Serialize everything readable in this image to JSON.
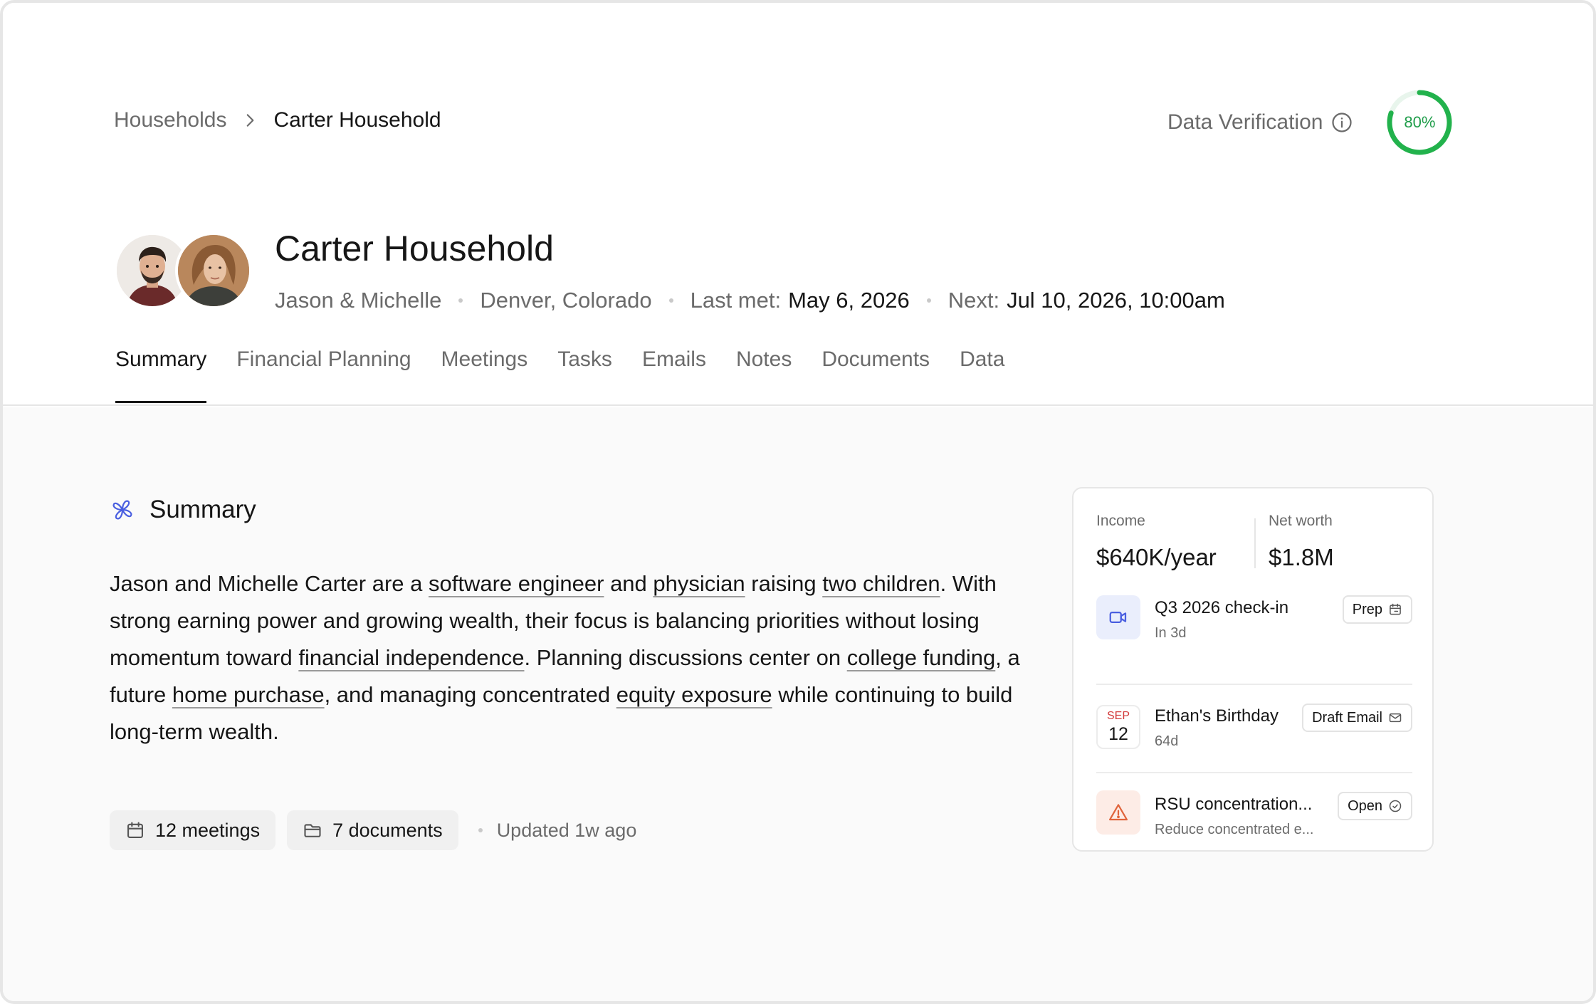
{
  "breadcrumb": {
    "parent": "Households",
    "current": "Carter Household"
  },
  "verification": {
    "label": "Data Verification",
    "percent_text": "80%",
    "progress": 0.8,
    "color": "#22b24c"
  },
  "household": {
    "title": "Carter Household",
    "members": "Jason & Michelle",
    "location": "Denver, Colorado",
    "last_met_label": "Last met:",
    "last_met_value": "May 6, 2026",
    "next_label": "Next:",
    "next_value": "Jul 10, 2026, 10:00am"
  },
  "tabs": [
    {
      "label": "Summary",
      "active": true
    },
    {
      "label": "Financial Planning"
    },
    {
      "label": "Meetings"
    },
    {
      "label": "Tasks"
    },
    {
      "label": "Emails"
    },
    {
      "label": "Notes"
    },
    {
      "label": "Documents"
    },
    {
      "label": "Data"
    }
  ],
  "summary": {
    "heading": "Summary",
    "parts": [
      "Jason and Michelle Carter are a ",
      "software engineer",
      " and ",
      "physician",
      " raising ",
      "two children",
      ". With strong earning power and growing wealth, their focus is balancing priorities without losing momentum toward ",
      "financial independence",
      ". Planning discussions center on ",
      "college funding",
      ", a future ",
      "home purchase",
      ", and managing concentrated ",
      "equity exposure",
      " while continuing to build long-term wealth."
    ],
    "meetings": "12 meetings",
    "documents": "7 documents",
    "updated": "Updated 1w ago"
  },
  "card": {
    "income_label": "Income",
    "income_value": "$640K/year",
    "networth_label": "Net worth",
    "networth_value": "$1.8M",
    "items": [
      {
        "title": "Q3 2026 check-in",
        "sub": "In 3d",
        "button": "Prep",
        "icon": "video-camera-icon"
      },
      {
        "title": "Ethan's Birthday",
        "sub": "64d",
        "button": "Draft Email",
        "month": "SEP",
        "day": "12",
        "icon": "calendar-date-icon"
      },
      {
        "title": "RSU concentration...",
        "sub": "Reduce concentrated e...",
        "button": "Open",
        "icon": "warning-icon"
      }
    ]
  },
  "colors": {
    "accent_blue": "#4a5fe0",
    "warning": "#e0643c",
    "success": "#22b24c"
  }
}
